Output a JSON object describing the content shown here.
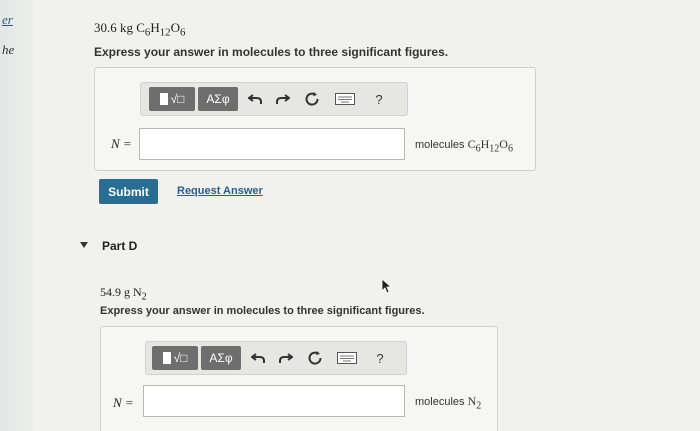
{
  "sidebar": {
    "top_fragment": "er",
    "bottom_fragment": "he"
  },
  "partC": {
    "given_amount": "30.6 kg",
    "given_formula_html": "C<sub>6</sub>H<sub>12</sub>O<sub>6</sub>",
    "prompt": "Express your answer in molecules to three significant figures.",
    "toolbar": {
      "templates_label": "√□",
      "symbols_label": "ΑΣφ",
      "help_label": "?"
    },
    "answer_label": "N =",
    "answer_value": "",
    "unit_prefix": "molecules",
    "unit_formula_html": "C<sub>6</sub>H<sub>12</sub>O<sub>6</sub>",
    "submit_label": "Submit",
    "request_label": "Request Answer"
  },
  "partD": {
    "header": "Part D",
    "given_amount": "54.9 g",
    "given_formula_html": "N<sub>2</sub>",
    "prompt": "Express your answer in molecules to three significant figures.",
    "toolbar": {
      "templates_label": "√□",
      "symbols_label": "ΑΣφ",
      "help_label": "?"
    },
    "answer_label": "N =",
    "answer_value": "",
    "unit_prefix": "molecules",
    "unit_formula_html": "N<sub>2</sub>"
  }
}
